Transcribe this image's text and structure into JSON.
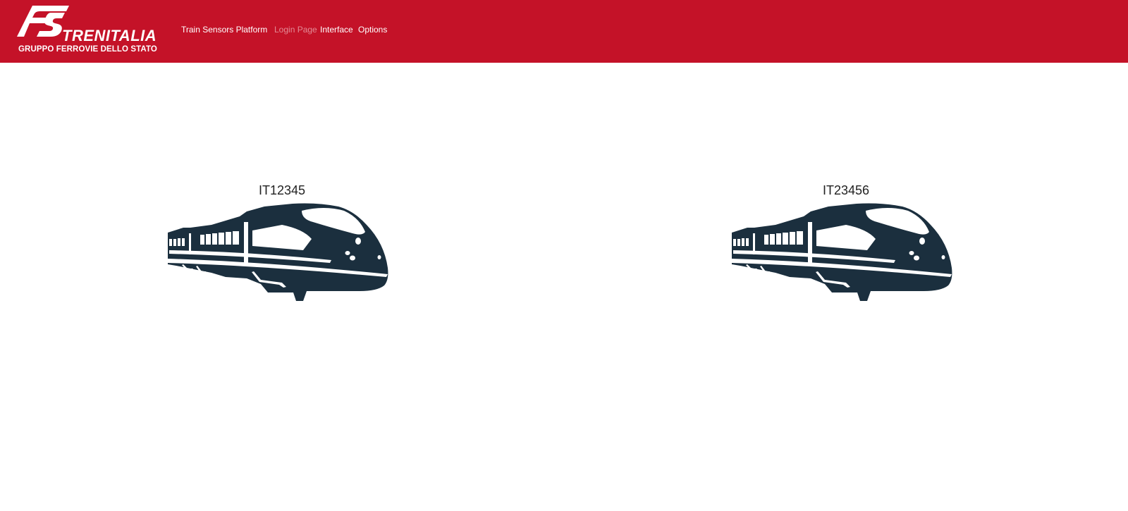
{
  "brand": {
    "wordmark": "TRENITALIA",
    "group": "GRUPPO FERROVIE DELLO STATO",
    "color": "#c41228"
  },
  "nav": {
    "app_title": "Train Sensors Platform",
    "links": [
      {
        "label": "Login Page",
        "state": "disabled"
      },
      {
        "label": "Interface",
        "state": "active"
      },
      {
        "label": "Options",
        "state": "active"
      }
    ]
  },
  "trains": [
    {
      "id": "IT12345",
      "icon": "train-icon"
    },
    {
      "id": "IT23456",
      "icon": "train-icon"
    }
  ],
  "colors": {
    "navbar": "#c41228",
    "train_silhouette": "#1b2f3e",
    "text": "#222222"
  }
}
